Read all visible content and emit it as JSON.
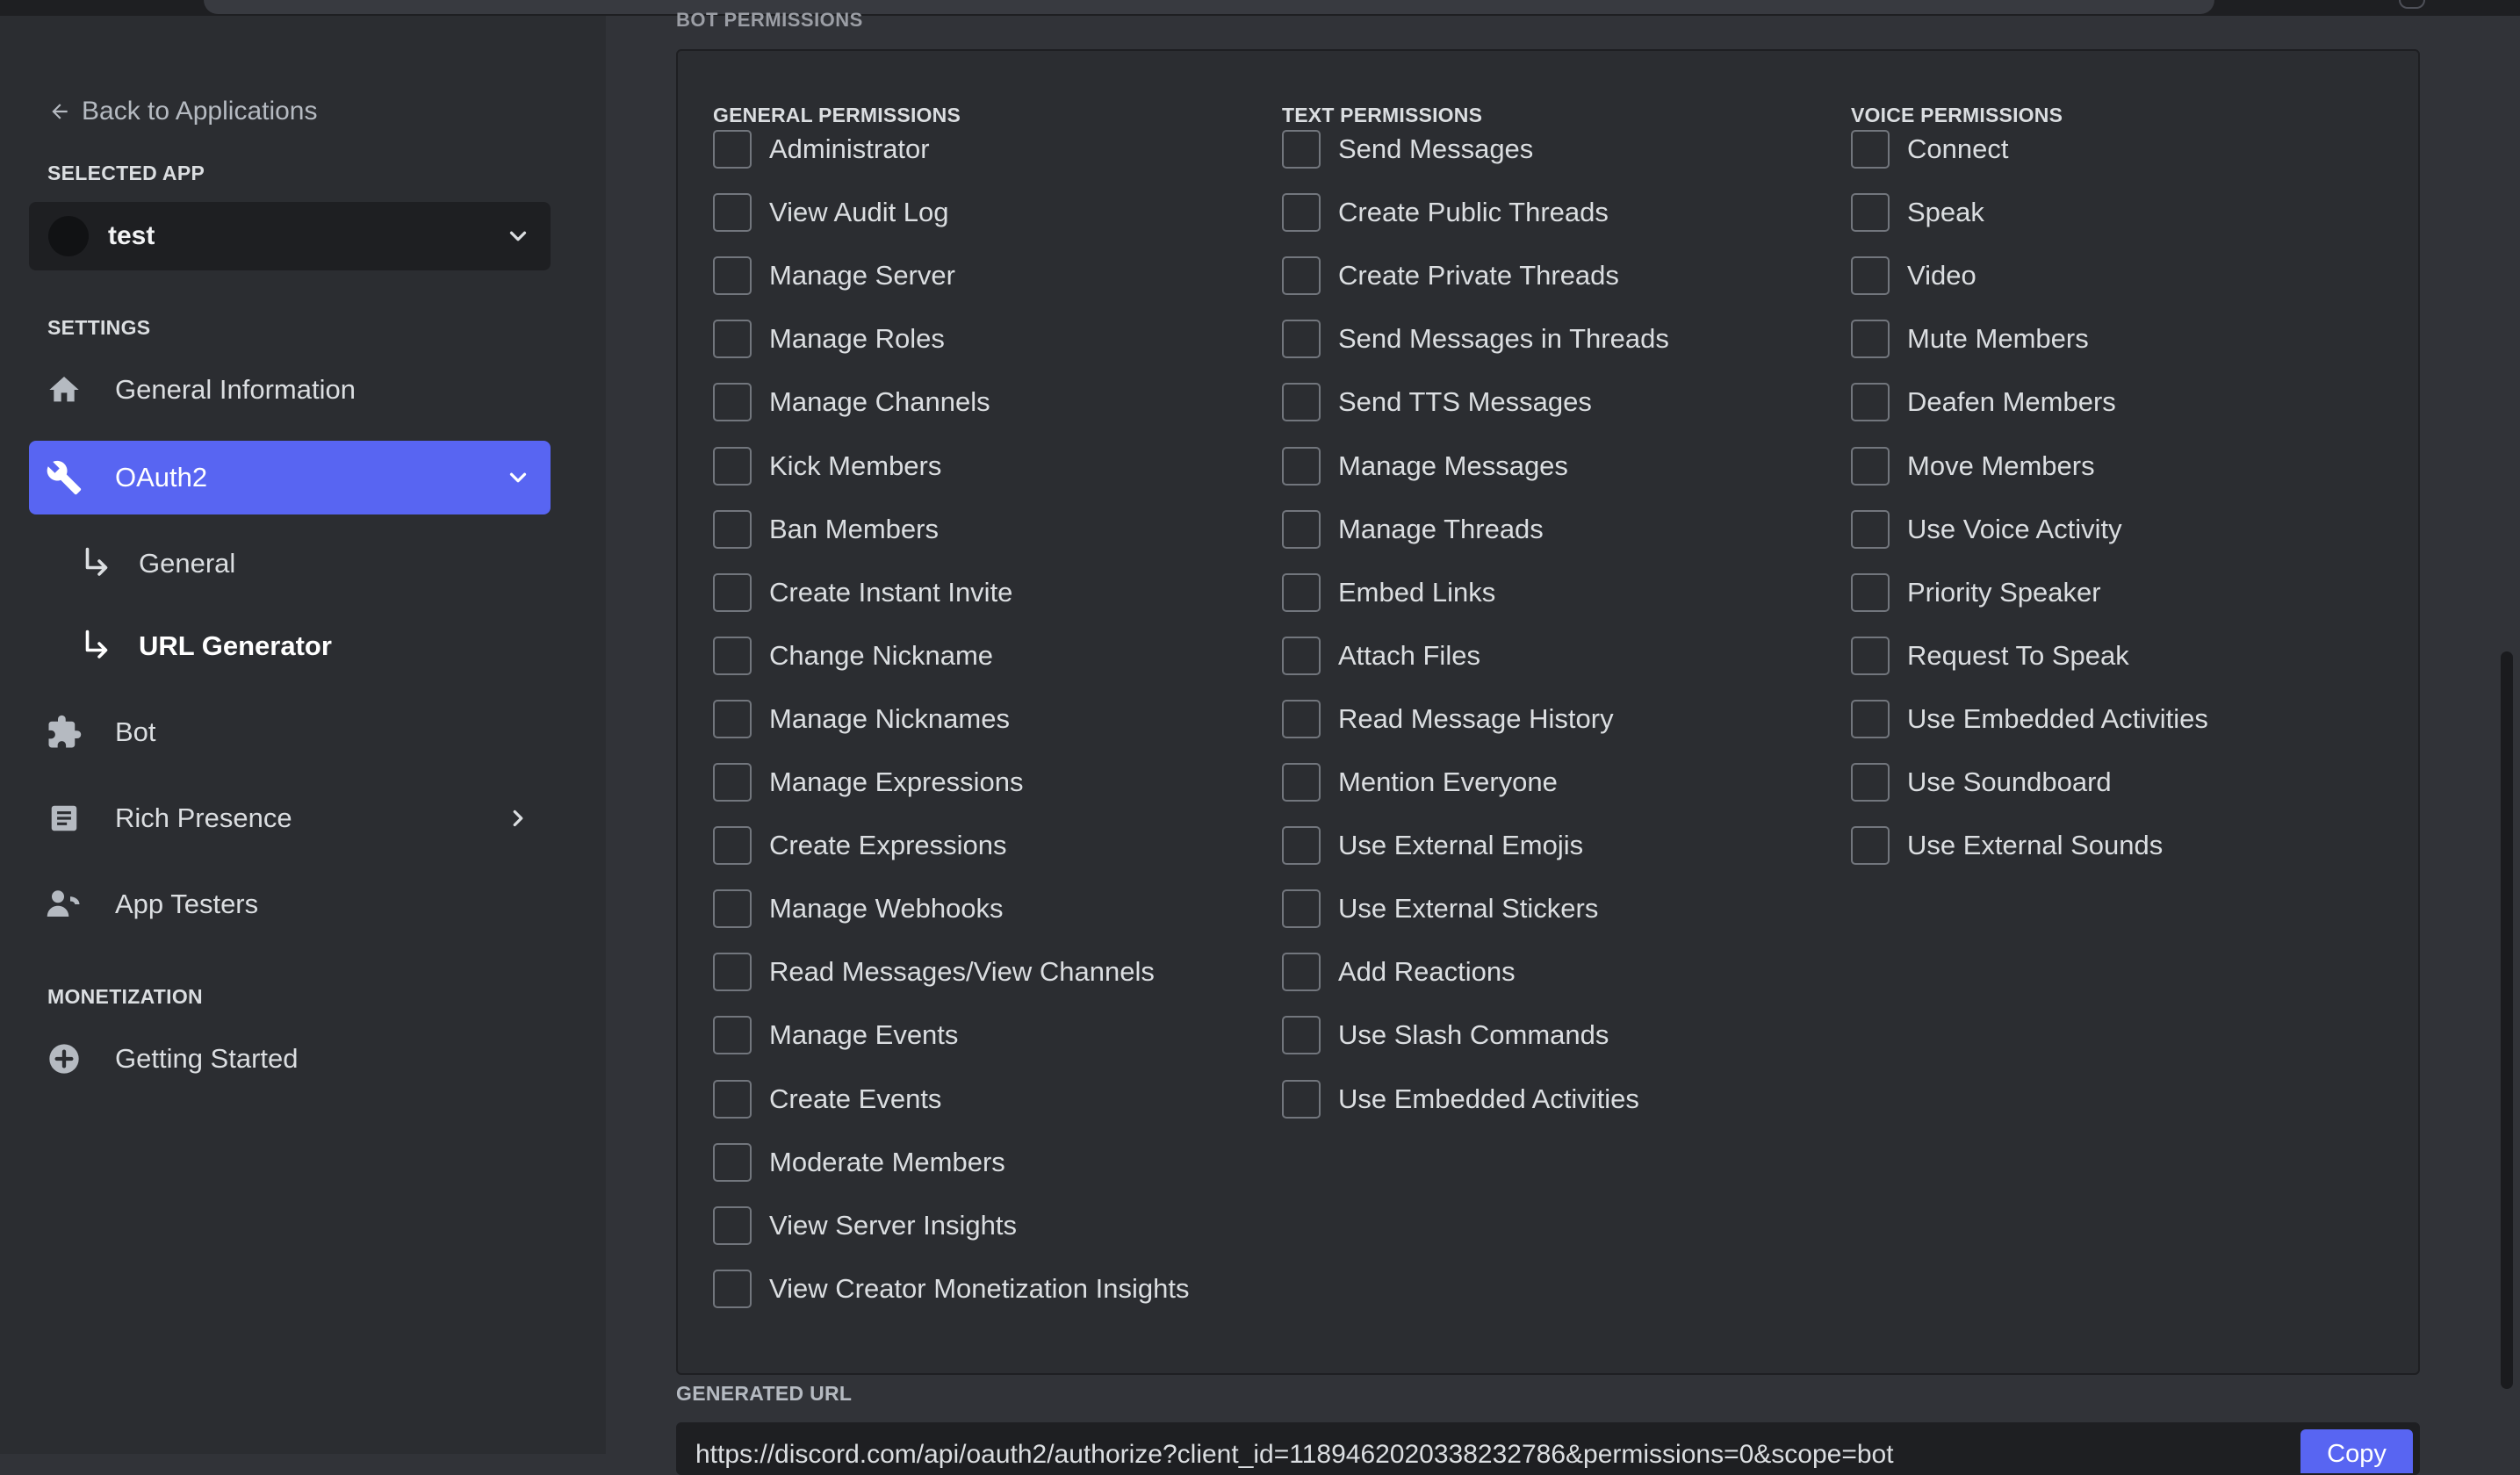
{
  "sidebar": {
    "back_label": "Back to Applications",
    "selected_app_label": "SELECTED APP",
    "app_name": "test",
    "settings_label": "SETTINGS",
    "items": [
      {
        "label": "General Information",
        "icon": "home-icon"
      },
      {
        "label": "OAuth2",
        "icon": "wrench-icon",
        "active": true,
        "expanded": true
      },
      {
        "label": "Bot",
        "icon": "puzzle-icon"
      },
      {
        "label": "Rich Presence",
        "icon": "document-icon"
      },
      {
        "label": "App Testers",
        "icon": "user-phone-icon"
      }
    ],
    "oauth_sub": [
      {
        "label": "General"
      },
      {
        "label": "URL Generator",
        "current": true
      }
    ],
    "monetization_label": "MONETIZATION",
    "monetization_items": [
      {
        "label": "Getting Started",
        "icon": "plus-circle-icon"
      }
    ]
  },
  "main": {
    "section_heading": "BOT PERMISSIONS",
    "columns": [
      {
        "title": "GENERAL PERMISSIONS",
        "items": [
          "Administrator",
          "View Audit Log",
          "Manage Server",
          "Manage Roles",
          "Manage Channels",
          "Kick Members",
          "Ban Members",
          "Create Instant Invite",
          "Change Nickname",
          "Manage Nicknames",
          "Manage Expressions",
          "Create Expressions",
          "Manage Webhooks",
          "Read Messages/View Channels",
          "Manage Events",
          "Create Events",
          "Moderate Members",
          "View Server Insights",
          "View Creator Monetization Insights"
        ]
      },
      {
        "title": "TEXT PERMISSIONS",
        "items": [
          "Send Messages",
          "Create Public Threads",
          "Create Private Threads",
          "Send Messages in Threads",
          "Send TTS Messages",
          "Manage Messages",
          "Manage Threads",
          "Embed Links",
          "Attach Files",
          "Read Message History",
          "Mention Everyone",
          "Use External Emojis",
          "Use External Stickers",
          "Add Reactions",
          "Use Slash Commands",
          "Use Embedded Activities"
        ]
      },
      {
        "title": "VOICE PERMISSIONS",
        "items": [
          "Connect",
          "Speak",
          "Video",
          "Mute Members",
          "Deafen Members",
          "Move Members",
          "Use Voice Activity",
          "Priority Speaker",
          "Request To Speak",
          "Use Embedded Activities",
          "Use Soundboard",
          "Use External Sounds"
        ]
      }
    ],
    "generated_url_label": "GENERATED URL",
    "generated_url_value": "https://discord.com/api/oauth2/authorize?client_id=1189462020338232786&permissions=0&scope=bot",
    "copy_label": "Copy"
  }
}
